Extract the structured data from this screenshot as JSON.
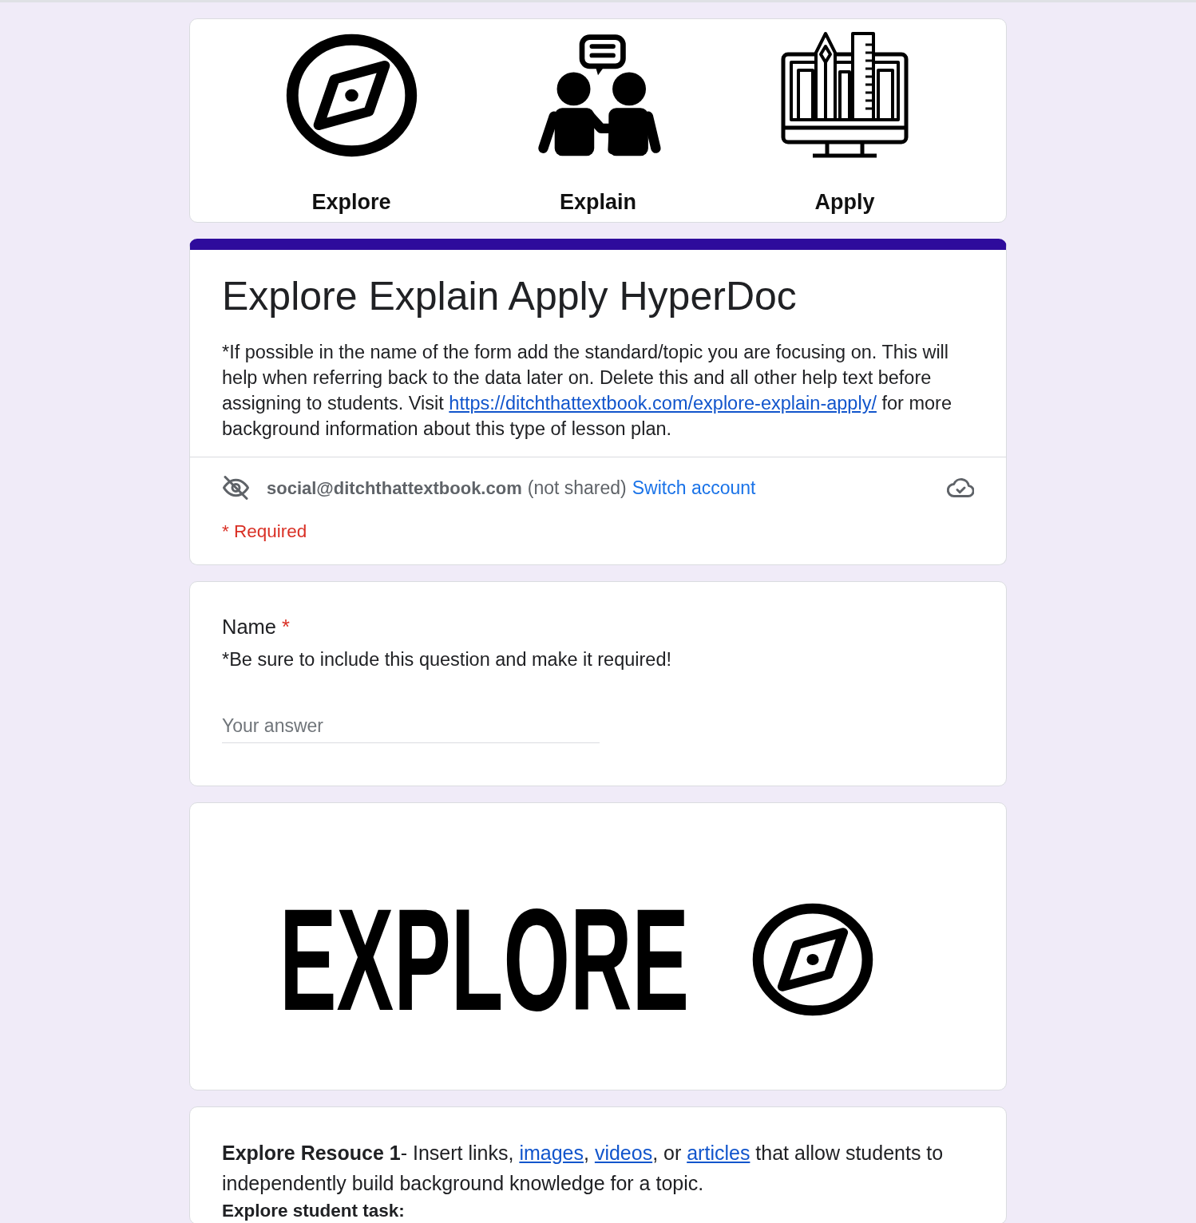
{
  "banner": {
    "items": [
      {
        "kind": "compass",
        "label": "Explore"
      },
      {
        "kind": "people",
        "label": "Explain"
      },
      {
        "kind": "monitor",
        "label": "Apply"
      }
    ]
  },
  "form_header": {
    "title": "Explore Explain Apply HyperDoc",
    "description": [
      {
        "kind": "text",
        "text": "*If possible in the name of the form add the standard/topic you are focusing on. This will help when referring back to the data later on. Delete this and all other help text before assigning to students. Visit "
      },
      {
        "kind": "link",
        "text": "https://ditchthattextbook.com/explore-explain-apply/"
      },
      {
        "kind": "text",
        "text": " for more background information about this type of lesson plan."
      }
    ],
    "account": {
      "email": "social@ditchthattextbook.com",
      "note": "(not shared)",
      "switch_link": "Switch account"
    },
    "required_notice": "* Required"
  },
  "questions": [
    {
      "kind": "short_answer",
      "title": "Name",
      "required": true,
      "required_mark": "*",
      "description": "*Be sure to include this question and make it required!",
      "placeholder": "Your answer"
    },
    {
      "kind": "image",
      "text": "EXPLORE"
    },
    {
      "kind": "text_block",
      "segments": [
        {
          "kind": "bold",
          "text": "Explore Resouce 1"
        },
        {
          "kind": "text",
          "text": "- Insert links, "
        },
        {
          "kind": "link",
          "text": "images"
        },
        {
          "kind": "text",
          "text": ", "
        },
        {
          "kind": "link",
          "text": "videos"
        },
        {
          "kind": "text",
          "text": ", or "
        },
        {
          "kind": "link",
          "text": "articles"
        },
        {
          "kind": "text",
          "text": " that allow students to independently build background knowledge for a topic."
        }
      ],
      "subheading": "Explore student task:"
    }
  ]
}
